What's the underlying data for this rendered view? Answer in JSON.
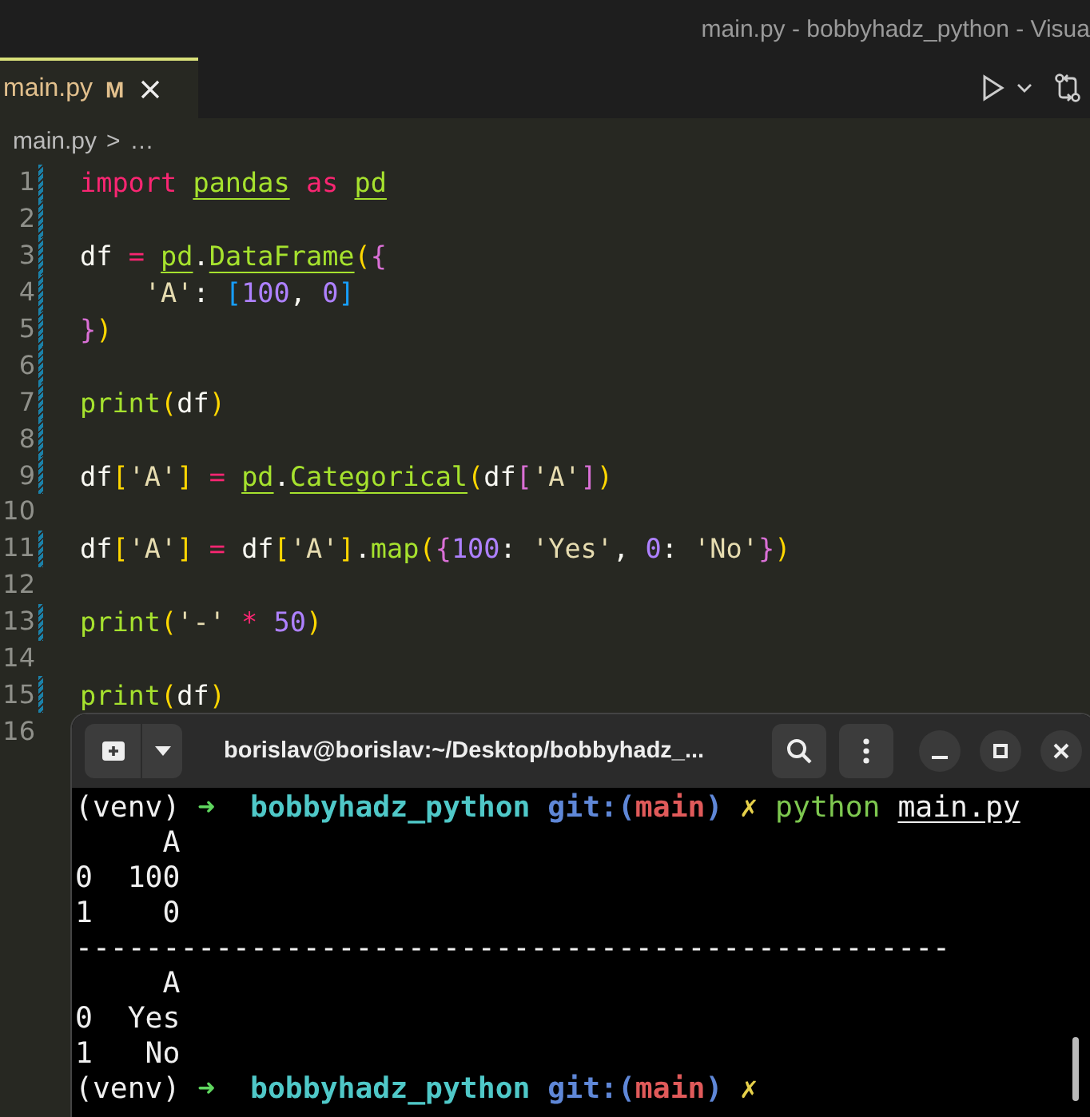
{
  "window": {
    "title": "main.py - bobbyhadz_python - Visua"
  },
  "tabs": [
    {
      "label": "main.py",
      "badge": "M",
      "selected": true
    }
  ],
  "breadcrumb": {
    "file": "main.py",
    "separator": ">",
    "rest": "…"
  },
  "editor": {
    "lines": [
      {
        "number": "1",
        "modified": true,
        "tokens": [
          {
            "text": "import",
            "kind": "keyword"
          },
          {
            "kind": "space"
          },
          {
            "text": "pandas",
            "kind": "link"
          },
          {
            "kind": "space"
          },
          {
            "text": "as",
            "kind": "keyword"
          },
          {
            "kind": "space"
          },
          {
            "text": "pd",
            "kind": "link"
          }
        ]
      },
      {
        "number": "2",
        "modified": true
      },
      {
        "number": "3",
        "modified": true,
        "tokens": [
          {
            "text": "df",
            "kind": "plain"
          },
          {
            "text": " = ",
            "kind": "op"
          },
          {
            "text": "pd",
            "kind": "link"
          },
          {
            "text": ".",
            "kind": "plain"
          },
          {
            "text": "DataFrame",
            "kind": "link"
          },
          {
            "text": "(",
            "kind": "bracket1"
          },
          {
            "text": "{",
            "kind": "bracket2"
          }
        ]
      },
      {
        "number": "4",
        "modified": true,
        "tokens": [
          {
            "text": "    'A'",
            "kind": "string"
          },
          {
            "text": ": ",
            "kind": "plain"
          },
          {
            "text": "[",
            "kind": "bracket3"
          },
          {
            "text": "100",
            "kind": "number"
          },
          {
            "text": ", ",
            "kind": "plain"
          },
          {
            "text": "0",
            "kind": "number"
          },
          {
            "text": "]",
            "kind": "bracket3"
          }
        ]
      },
      {
        "number": "5",
        "modified": true,
        "tokens": [
          {
            "text": "}",
            "kind": "bracket2"
          },
          {
            "text": ")",
            "kind": "bracket1"
          }
        ]
      },
      {
        "number": "6",
        "modified": true
      },
      {
        "number": "7",
        "modified": true,
        "tokens": [
          {
            "text": "print",
            "kind": "func"
          },
          {
            "text": "(",
            "kind": "bracket1"
          },
          {
            "text": "df",
            "kind": "plain"
          },
          {
            "text": ")",
            "kind": "bracket1"
          }
        ]
      },
      {
        "number": "8",
        "modified": true
      },
      {
        "number": "9",
        "modified": true,
        "tokens": [
          {
            "text": "df",
            "kind": "plain"
          },
          {
            "text": "[",
            "kind": "bracket1"
          },
          {
            "text": "'A'",
            "kind": "string"
          },
          {
            "text": "]",
            "kind": "bracket1"
          },
          {
            "text": " = ",
            "kind": "op"
          },
          {
            "text": "pd",
            "kind": "link"
          },
          {
            "text": ".",
            "kind": "plain"
          },
          {
            "text": "Categorical",
            "kind": "link"
          },
          {
            "text": "(",
            "kind": "bracket1"
          },
          {
            "text": "df",
            "kind": "plain"
          },
          {
            "text": "[",
            "kind": "bracket2"
          },
          {
            "text": "'A'",
            "kind": "string"
          },
          {
            "text": "]",
            "kind": "bracket2"
          },
          {
            "text": ")",
            "kind": "bracket1"
          }
        ]
      },
      {
        "number": "10",
        "modified": false
      },
      {
        "number": "11",
        "modified": true,
        "tokens": [
          {
            "text": "df",
            "kind": "plain"
          },
          {
            "text": "[",
            "kind": "bracket1"
          },
          {
            "text": "'A'",
            "kind": "string"
          },
          {
            "text": "]",
            "kind": "bracket1"
          },
          {
            "text": " = ",
            "kind": "op"
          },
          {
            "text": "df",
            "kind": "plain"
          },
          {
            "text": "[",
            "kind": "bracket1"
          },
          {
            "text": "'A'",
            "kind": "string"
          },
          {
            "text": "]",
            "kind": "bracket1"
          },
          {
            "text": ".",
            "kind": "plain"
          },
          {
            "text": "map",
            "kind": "func"
          },
          {
            "text": "(",
            "kind": "bracket1"
          },
          {
            "text": "{",
            "kind": "bracket2"
          },
          {
            "text": "100",
            "kind": "number"
          },
          {
            "text": ": ",
            "kind": "plain"
          },
          {
            "text": "'Yes'",
            "kind": "string"
          },
          {
            "text": ", ",
            "kind": "plain"
          },
          {
            "text": "0",
            "kind": "number"
          },
          {
            "text": ": ",
            "kind": "plain"
          },
          {
            "text": "'No'",
            "kind": "string"
          },
          {
            "text": "}",
            "kind": "bracket2"
          },
          {
            "text": ")",
            "kind": "bracket1"
          }
        ]
      },
      {
        "number": "12",
        "modified": false
      },
      {
        "number": "13",
        "modified": true,
        "tokens": [
          {
            "text": "print",
            "kind": "func"
          },
          {
            "text": "(",
            "kind": "bracket1"
          },
          {
            "text": "'-'",
            "kind": "string"
          },
          {
            "text": " * ",
            "kind": "op"
          },
          {
            "text": "50",
            "kind": "number"
          },
          {
            "text": ")",
            "kind": "bracket1"
          }
        ]
      },
      {
        "number": "14",
        "modified": false
      },
      {
        "number": "15",
        "modified": true,
        "tokens": [
          {
            "text": "print",
            "kind": "func"
          },
          {
            "text": "(",
            "kind": "bracket1"
          },
          {
            "text": "df",
            "kind": "plain"
          },
          {
            "text": ")",
            "kind": "bracket1"
          }
        ]
      },
      {
        "number": "16",
        "modified": false
      }
    ]
  },
  "terminal": {
    "title": "borislav@borislav:~/Desktop/bobbyhadz_...",
    "lines": [
      {
        "segments": [
          {
            "text": "(venv) ",
            "kind": "plain"
          },
          {
            "text": "➜  ",
            "kind": "arrow"
          },
          {
            "text": "bobbyhadz_python ",
            "kind": "dir"
          },
          {
            "text": "git:(",
            "kind": "git"
          },
          {
            "text": "main",
            "kind": "branch"
          },
          {
            "text": ") ",
            "kind": "git"
          },
          {
            "text": "✗ ",
            "kind": "dirty"
          },
          {
            "text": "python ",
            "kind": "cmd"
          },
          {
            "text": "main.py",
            "kind": "arg"
          }
        ]
      },
      {
        "segments": [
          {
            "text": "     A",
            "kind": "plain"
          }
        ]
      },
      {
        "segments": [
          {
            "text": "0  100",
            "kind": "plain"
          }
        ]
      },
      {
        "segments": [
          {
            "text": "1    0",
            "kind": "plain"
          }
        ]
      },
      {
        "segments": [
          {
            "text": "--------------------------------------------------",
            "kind": "plain"
          }
        ]
      },
      {
        "segments": [
          {
            "text": "     A",
            "kind": "plain"
          }
        ]
      },
      {
        "segments": [
          {
            "text": "0  Yes",
            "kind": "plain"
          }
        ]
      },
      {
        "segments": [
          {
            "text": "1   No",
            "kind": "plain"
          }
        ]
      },
      {
        "segments": [
          {
            "text": "(venv) ",
            "kind": "plain"
          },
          {
            "text": "➜  ",
            "kind": "arrow"
          },
          {
            "text": "bobbyhadz_python ",
            "kind": "dir"
          },
          {
            "text": "git:(",
            "kind": "git"
          },
          {
            "text": "main",
            "kind": "branch"
          },
          {
            "text": ") ",
            "kind": "git"
          },
          {
            "text": "✗",
            "kind": "dirty"
          }
        ]
      }
    ]
  }
}
